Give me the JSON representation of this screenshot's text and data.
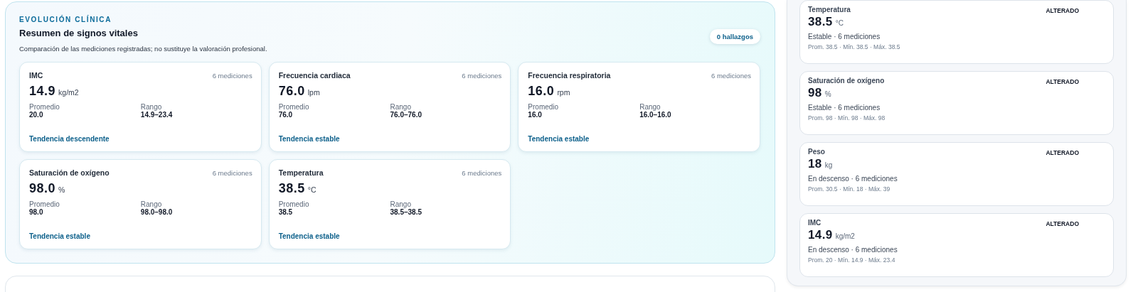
{
  "header": {
    "eyebrow": "EVOLUCIÓN CLÍNICA",
    "title": "Resumen de signos vitales",
    "subtitle": "Comparación de las mediciones registradas; no sustituye la valoración profesional.",
    "findings_badge": "0 hallazgos"
  },
  "vitals": [
    {
      "name": "IMC",
      "count": "6 mediciones",
      "value": "14.9",
      "unit": "kg/m2",
      "average_label": "Promedio",
      "average": "20.0",
      "range_label": "Rango",
      "range": "14.9–23.4",
      "trend": "Tendencia descendente"
    },
    {
      "name": "Frecuencia cardiaca",
      "count": "6 mediciones",
      "value": "76.0",
      "unit": "lpm",
      "average_label": "Promedio",
      "average": "76.0",
      "range_label": "Rango",
      "range": "76.0–76.0",
      "trend": "Tendencia estable"
    },
    {
      "name": "Frecuencia respiratoria",
      "count": "6 mediciones",
      "value": "16.0",
      "unit": "rpm",
      "average_label": "Promedio",
      "average": "16.0",
      "range_label": "Rango",
      "range": "16.0–16.0",
      "trend": "Tendencia estable"
    },
    {
      "name": "Saturación de oxígeno",
      "count": "6 mediciones",
      "value": "98.0",
      "unit": "%",
      "average_label": "Promedio",
      "average": "98.0",
      "range_label": "Rango",
      "range": "98.0–98.0",
      "trend": "Tendencia estable"
    },
    {
      "name": "Temperatura",
      "count": "6 mediciones",
      "value": "38.5",
      "unit": "°C",
      "average_label": "Promedio",
      "average": "38.5",
      "range_label": "Rango",
      "range": "38.5–38.5",
      "trend": "Tendencia estable"
    }
  ],
  "summary": [
    {
      "name": "Temperatura",
      "value": "38.5",
      "unit": "°C",
      "status": "ALTERADO",
      "trend": "Estable · 6 mediciones",
      "stats": "Prom. 38.5 · Mín. 38.5 · Máx. 38.5"
    },
    {
      "name": "Saturación de oxígeno",
      "value": "98",
      "unit": "%",
      "status": "ALTERADO",
      "trend": "Estable · 6 mediciones",
      "stats": "Prom. 98 · Mín. 98 · Máx. 98"
    },
    {
      "name": "Peso",
      "value": "18",
      "unit": "kg",
      "status": "ALTERADO",
      "trend": "En descenso · 6 mediciones",
      "stats": "Prom. 30.5 · Mín. 18 · Máx. 39"
    },
    {
      "name": "IMC",
      "value": "14.9",
      "unit": "kg/m2",
      "status": "ALTERADO",
      "trend": "En descenso · 6 mediciones",
      "stats": "Prom. 20 · Mín. 14.9 · Máx. 23.4"
    }
  ]
}
